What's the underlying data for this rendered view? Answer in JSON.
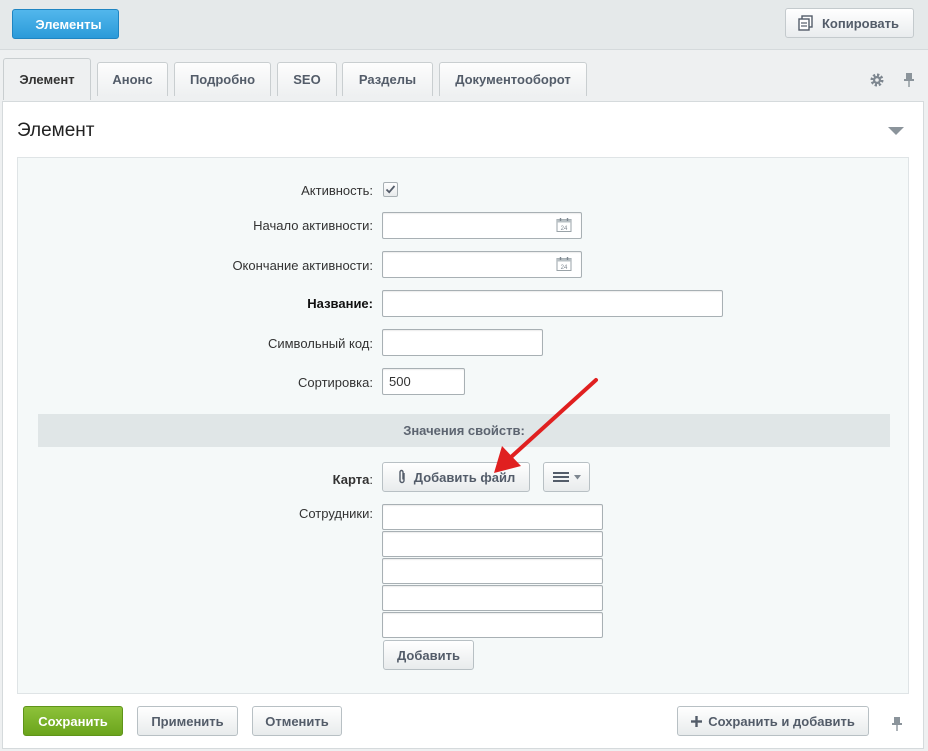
{
  "toolbar": {
    "back_label": "Элементы",
    "copy_label": "Копировать",
    "copy_icon": "copy-icon"
  },
  "tabs": [
    {
      "label": "Элемент",
      "active": true
    },
    {
      "label": "Анонс",
      "active": false
    },
    {
      "label": "Подробно",
      "active": false
    },
    {
      "label": "SEO",
      "active": false
    },
    {
      "label": "Разделы",
      "active": false
    },
    {
      "label": "Документооборот",
      "active": false
    }
  ],
  "section": {
    "title": "Элемент"
  },
  "form": {
    "active_label": "Активность:",
    "active_checked": true,
    "start_label": "Начало активности:",
    "start_value": "",
    "end_label": "Окончание активности:",
    "end_value": "",
    "name_label": "Название:",
    "name_value": "",
    "code_label": "Символьный код:",
    "code_value": "",
    "sort_label": "Сортировка:",
    "sort_value": "500"
  },
  "properties": {
    "header": "Значения свойств:",
    "map_label": "Карта",
    "map_colon": ":",
    "add_file_label": "Добавить файл",
    "employees_label": "Сотрудники:",
    "employees_values": [
      "",
      "",
      "",
      "",
      ""
    ],
    "add_label": "Добавить"
  },
  "footer": {
    "save_label": "Сохранить",
    "apply_label": "Применить",
    "cancel_label": "Отменить",
    "save_add_label": "Сохранить и добавить"
  },
  "colors": {
    "accent": "#2b9ad9",
    "save_green": "#7ab52a",
    "annotation_red": "#e02020"
  }
}
